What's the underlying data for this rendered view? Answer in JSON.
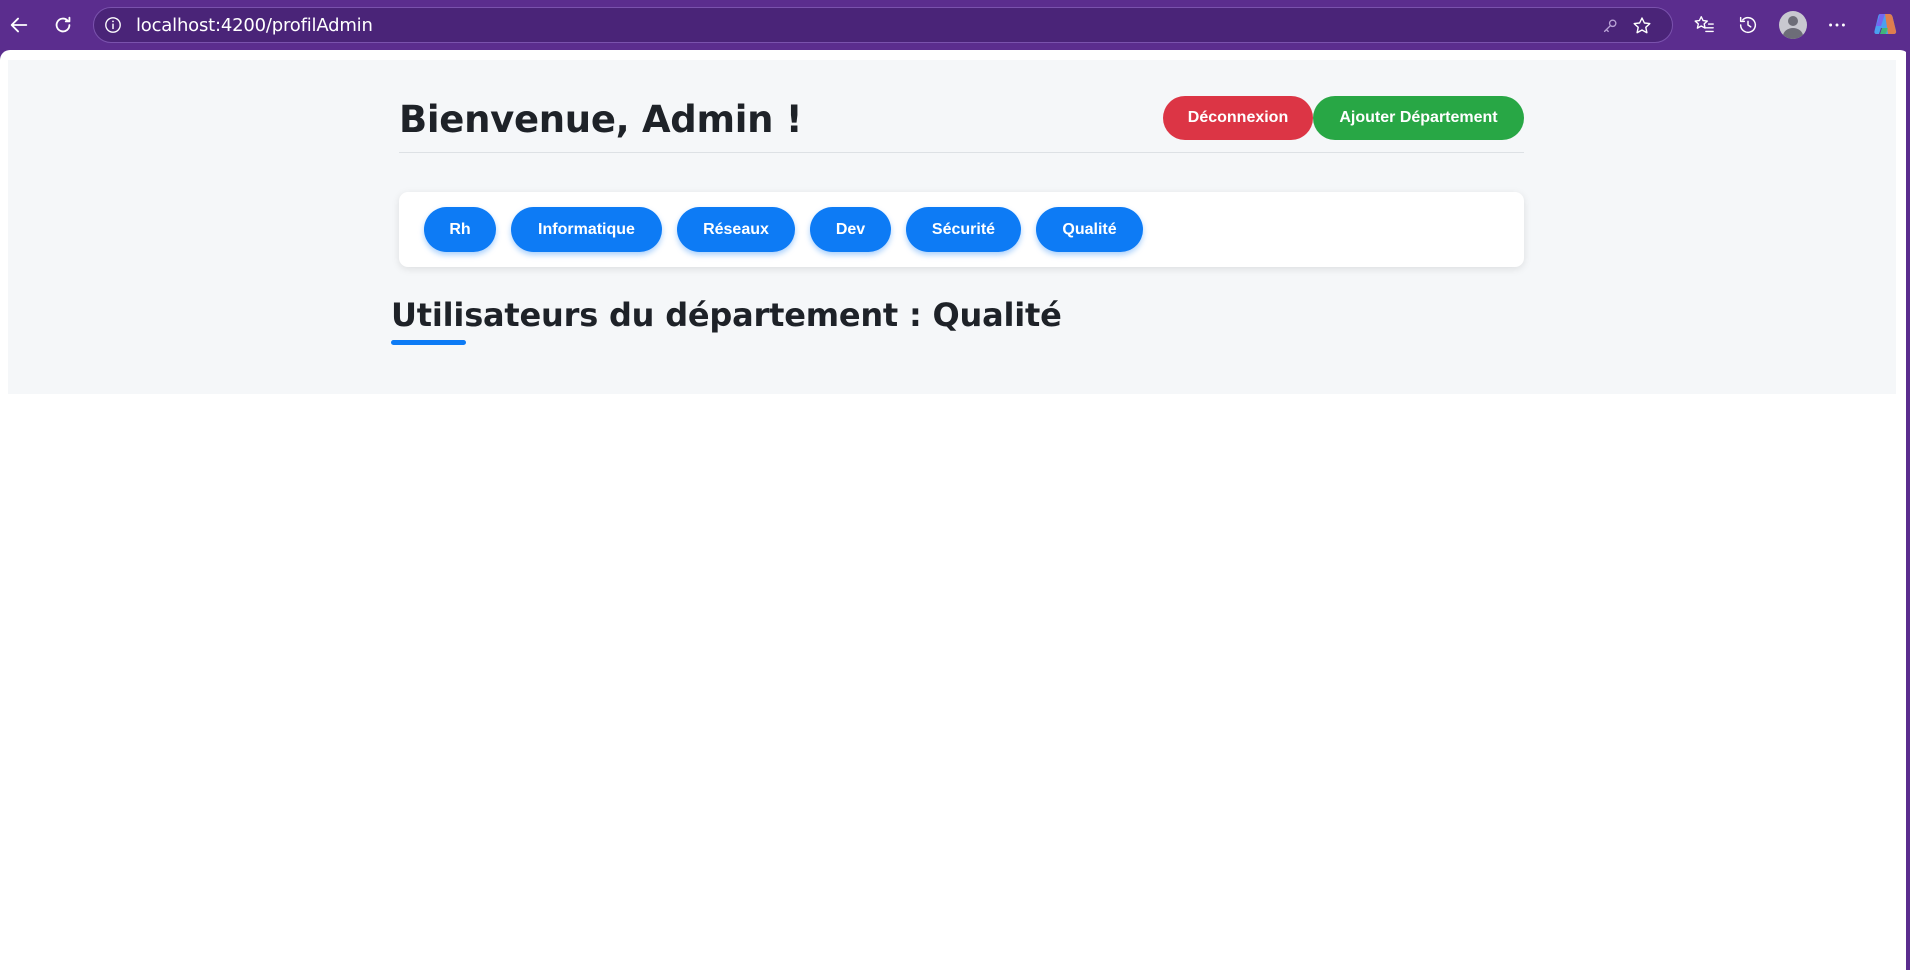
{
  "browser": {
    "url": "localhost:4200/profilAdmin",
    "colors": {
      "frame": "#5b2d8e",
      "address_bg": "#4a2478"
    },
    "icons": [
      "back-arrow-icon",
      "refresh-icon",
      "info-icon",
      "key-icon",
      "star-icon",
      "favorites-icon",
      "history-icon",
      "profile-avatar-icon",
      "more-icon",
      "copilot-icon"
    ]
  },
  "header": {
    "title": "Bienvenue, Admin !",
    "logout_label": "Déconnexion",
    "add_department_label": "Ajouter Département"
  },
  "departments": {
    "items": [
      {
        "label": "Rh"
      },
      {
        "label": "Informatique"
      },
      {
        "label": "Réseaux"
      },
      {
        "label": "Dev"
      },
      {
        "label": "Sécurité"
      },
      {
        "label": "Qualité"
      }
    ]
  },
  "section": {
    "title": "Utilisateurs du département : Qualité"
  },
  "colors": {
    "primary": "#0d7bf5",
    "danger": "#dc3545",
    "success": "#28a745",
    "page_bg": "#f5f7f9"
  }
}
